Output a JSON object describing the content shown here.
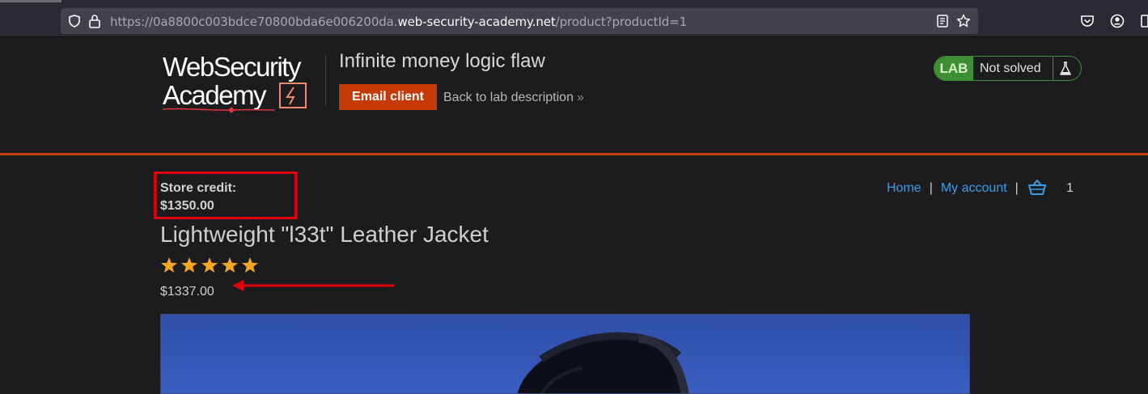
{
  "browser": {
    "url_prefix": "https://0a8800c003bdce70800bda6e006200da.",
    "url_domain": "web-security-academy.net",
    "url_path": "/product?productId=1"
  },
  "header": {
    "logo_line1": "WebSecurity",
    "logo_line2": "Academy",
    "lab_title": "Infinite money logic flaw",
    "email_client_label": "Email client",
    "back_link_label": "Back to lab description",
    "lab_badge": "LAB",
    "lab_status": "Not solved"
  },
  "account": {
    "store_credit_label": "Store credit:",
    "store_credit_value": "$1350.00"
  },
  "nav": {
    "home": "Home",
    "my_account": "My account",
    "cart_count": "1"
  },
  "product": {
    "title": "Lightweight \"l33t\" Leather Jacket",
    "rating": 5,
    "price": "$1337.00"
  },
  "colors": {
    "accent": "#c63a07",
    "lab_green": "#3e8f34",
    "link": "#3c9be3",
    "highlight": "#e0000e"
  }
}
